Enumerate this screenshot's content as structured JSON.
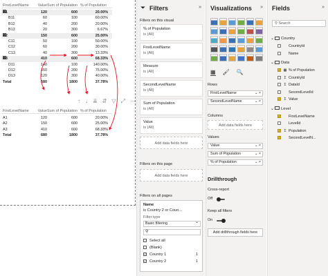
{
  "matrix": {
    "headers": [
      "FirstLevelName",
      "Value",
      "Sum of Population",
      "% of Population"
    ],
    "rows": [
      {
        "kind": "group",
        "label": "A1",
        "value": "120",
        "sum": "600",
        "pct": "20.00%",
        "expander": "⊟"
      },
      {
        "kind": "child",
        "label": "B11",
        "value": "60",
        "sum": "100",
        "pct": "60.00%"
      },
      {
        "kind": "child",
        "label": "B12",
        "value": "40",
        "sum": "200",
        "pct": "20.00%"
      },
      {
        "kind": "child",
        "label": "B13",
        "value": "20",
        "sum": "300",
        "pct": "6.67%"
      },
      {
        "kind": "group",
        "label": "A2",
        "value": "150",
        "sum": "600",
        "pct": "25.00%",
        "expander": "⊟"
      },
      {
        "kind": "child",
        "label": "C11",
        "value": "50",
        "sum": "100",
        "pct": "50.00%"
      },
      {
        "kind": "child",
        "label": "C12",
        "value": "60",
        "sum": "200",
        "pct": "30.00%"
      },
      {
        "kind": "child",
        "label": "C13",
        "value": "40",
        "sum": "300",
        "pct": "13.33%"
      },
      {
        "kind": "group",
        "label": "A3",
        "value": "410",
        "sum": "600",
        "pct": "68.33%",
        "expander": "⊟"
      },
      {
        "kind": "child",
        "label": "D11",
        "value": "140",
        "sum": "100",
        "pct": "140.00%"
      },
      {
        "kind": "child",
        "label": "D12",
        "value": "150",
        "sum": "200",
        "pct": "75.00%"
      },
      {
        "kind": "child",
        "label": "D13",
        "value": "120",
        "sum": "300",
        "pct": "40.00%"
      },
      {
        "kind": "total",
        "label": "Total",
        "value": "680",
        "sum": "1800",
        "pct": "37.78%"
      }
    ]
  },
  "table2": {
    "headers": [
      "FirstLevelName",
      "Value",
      "Sum of Population",
      "% of Population"
    ],
    "rows": [
      {
        "label": "A1",
        "value": "120",
        "sum": "600",
        "pct": "20.00%"
      },
      {
        "label": "A2",
        "value": "150",
        "sum": "600",
        "pct": "25.00%"
      },
      {
        "label": "A3",
        "value": "410",
        "sum": "600",
        "pct": "68.33%"
      },
      {
        "label": "Total",
        "value": "680",
        "sum": "1800",
        "pct": "37.78%"
      }
    ]
  },
  "visual_toolbar": [
    "↑",
    "↓",
    "⇊",
    "⇵",
    "▽",
    "⤢",
    "⋯"
  ],
  "filters": {
    "title": "Filters",
    "this_visual_label": "Filters on this visual",
    "visual_cards": [
      {
        "title": "% of Population",
        "state": "is (All)"
      },
      {
        "title": "FirstLevelName",
        "state": "is (All)"
      },
      {
        "title": "Measure",
        "state": "is (All)"
      },
      {
        "title": "SecondLevelName",
        "state": "is (All)"
      },
      {
        "title": "Sum of Population",
        "state": "is (All)"
      },
      {
        "title": "Value",
        "state": "is (All)"
      }
    ],
    "add_fields": "Add data fields here",
    "this_page_label": "Filters on this page",
    "all_pages_label": "Filters on all pages",
    "country_card": {
      "name": "Name",
      "condition": "is Country 2 or Coun...",
      "filter_type_label": "Filter type",
      "filter_type_value": "Basic filtering",
      "search_glyph": "⚲",
      "items": [
        {
          "label": "Select all",
          "checked": false,
          "count": ""
        },
        {
          "label": "(Blank)",
          "checked": false,
          "count": ""
        },
        {
          "label": "Country 1",
          "checked": true,
          "count": "1"
        },
        {
          "label": "Country 2",
          "checked": true,
          "count": "1"
        }
      ]
    }
  },
  "viz": {
    "title": "Visualizations",
    "icon_colors": [
      "#3b6fb6",
      "#e8a33d",
      "#5b9bd5",
      "#70ad47",
      "#3b6fb6",
      "#e8a33d",
      "#5b9bd5",
      "#3b6fb6",
      "#e8a33d",
      "#70ad47",
      "#c0504d",
      "#8064a2",
      "#4bacc6",
      "#f79646",
      "#3b6fb6",
      "#5b9bd5",
      "#e8a33d",
      "#70ad47",
      "#555555",
      "#3b6fb6",
      "#2e75b6",
      "#e8a33d",
      "#8c8c8c",
      "#5b9bd5",
      "#70ad47",
      "#3b6fb6",
      "#e8a33d",
      "#4472c4",
      "#c55a11",
      "#7f7f7f"
    ],
    "tabs": [
      "▦",
      "🖌",
      "🔍"
    ],
    "rows_label": "Rows",
    "rows_fields": [
      "FirstLevelName",
      "SecondLevelName"
    ],
    "columns_label": "Columns",
    "add_fields": "Add data fields here",
    "values_label": "Values",
    "values_fields": [
      "Value",
      "Sum of Population",
      "% of Population"
    ],
    "drillthrough_title": "Drillthrough",
    "cross_report_label": "Cross-report",
    "cross_report_state": "Off",
    "keep_filters_label": "Keep all filters",
    "keep_filters_state": "On",
    "add_drill": "Add drillthrough fields here"
  },
  "fields": {
    "title": "Fields",
    "search_placeholder": "Search",
    "tables": [
      {
        "name": "Country",
        "items": [
          {
            "label": "CountryId",
            "checked": false,
            "glyph": ""
          },
          {
            "label": "Name",
            "checked": false,
            "glyph": ""
          }
        ]
      },
      {
        "name": "Data",
        "items": [
          {
            "label": "% of Population",
            "checked": true,
            "glyph": "▦"
          },
          {
            "label": "CountryId",
            "checked": false,
            "glyph": "Σ"
          },
          {
            "label": "DataId",
            "checked": false,
            "glyph": "Σ"
          },
          {
            "label": "SecondLevelId",
            "checked": false,
            "glyph": ""
          },
          {
            "label": "Value",
            "checked": true,
            "glyph": "Σ"
          }
        ]
      },
      {
        "name": "Level",
        "items": [
          {
            "label": "FirstLevelName",
            "checked": true,
            "glyph": ""
          },
          {
            "label": "LevelId",
            "checked": false,
            "glyph": ""
          },
          {
            "label": "Population",
            "checked": true,
            "glyph": "Σ"
          },
          {
            "label": "SecondLevelN...",
            "checked": true,
            "glyph": ""
          }
        ]
      }
    ]
  }
}
